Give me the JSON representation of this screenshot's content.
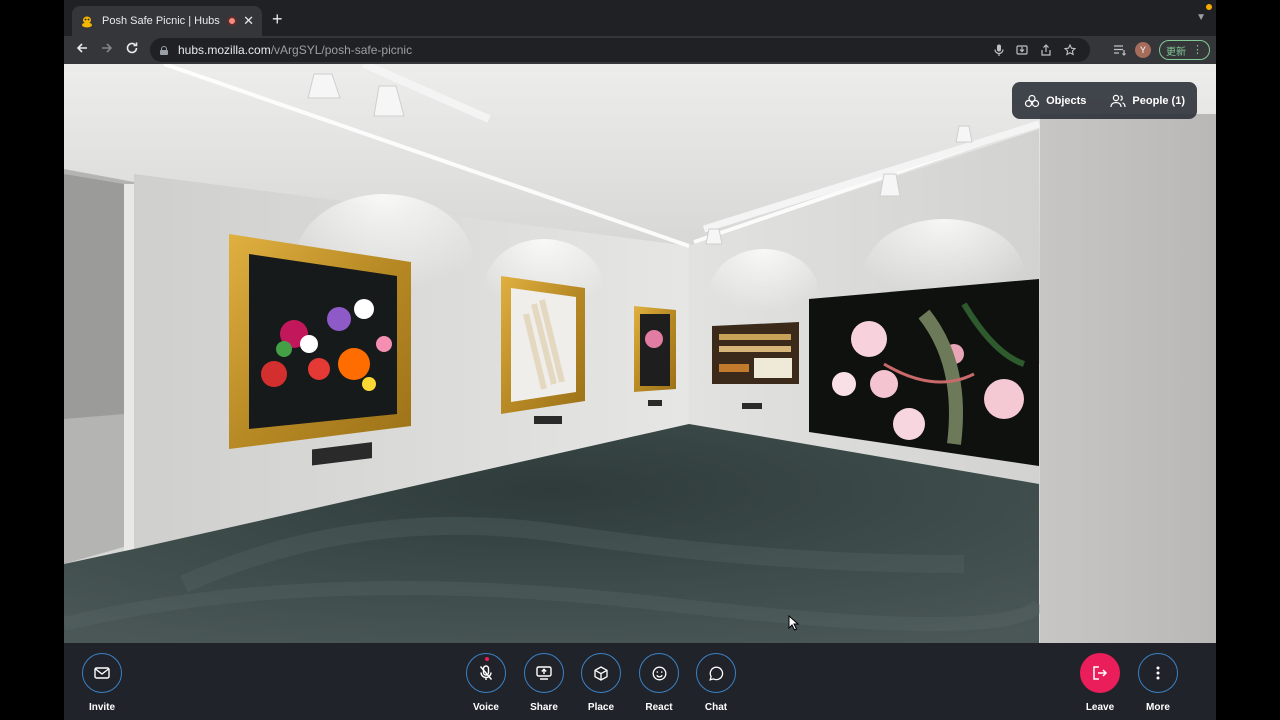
{
  "browser": {
    "tab_title": "Posh Safe Picnic | Hubs by",
    "new_tab_symbol": "+",
    "url_host": "hubs.mozilla.com",
    "url_path": "/vArgSYL/posh-safe-picnic",
    "update_label": "更新",
    "avatar_letter": "Y"
  },
  "panel": {
    "objects_label": "Objects",
    "people_label": "People (1)"
  },
  "bottom_bar": {
    "invite_label": "Invite",
    "voice_label": "Voice",
    "share_label": "Share",
    "place_label": "Place",
    "react_label": "React",
    "chat_label": "Chat",
    "leave_label": "Leave",
    "more_label": "More"
  },
  "colors": {
    "accent_blue": "#3b82c4",
    "leave_red": "#e91e5a",
    "bar_bg": "#20232a"
  }
}
